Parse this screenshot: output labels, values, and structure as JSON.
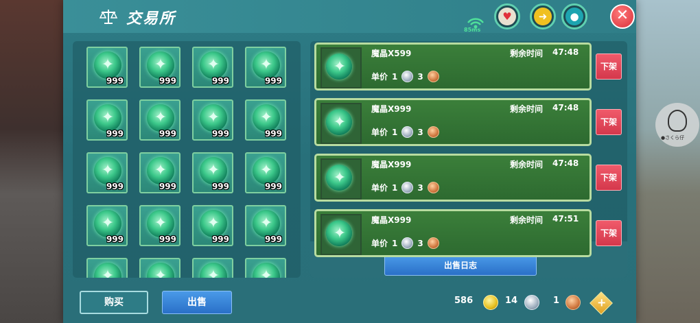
{
  "title": "交易所",
  "ping": "85ms",
  "icons": {
    "title": "balance-scale-icon",
    "close": "close-icon",
    "wifi": "wifi-icon",
    "health": "heart-icon",
    "hunger": "arrow-icon",
    "water": "water-drop-icon"
  },
  "close_label": "✕",
  "inventory": {
    "slots": [
      {
        "qty": "999"
      },
      {
        "qty": "999"
      },
      {
        "qty": "999"
      },
      {
        "qty": "999"
      },
      {
        "qty": "999"
      },
      {
        "qty": "999"
      },
      {
        "qty": "999"
      },
      {
        "qty": "999"
      },
      {
        "qty": "999"
      },
      {
        "qty": "999"
      },
      {
        "qty": "999"
      },
      {
        "qty": "999"
      },
      {
        "qty": "999"
      },
      {
        "qty": "999"
      },
      {
        "qty": "999"
      },
      {
        "qty": "999"
      },
      {
        "qty": ""
      },
      {
        "qty": ""
      },
      {
        "qty": ""
      },
      {
        "qty": ""
      }
    ]
  },
  "listings": [
    {
      "name": "魔晶X599",
      "remain_label": "剩余时间",
      "time": "47:48",
      "price_label": "单价",
      "silver": "1",
      "bronze": "3",
      "delist": "下架"
    },
    {
      "name": "魔晶X999",
      "remain_label": "剩余时间",
      "time": "47:48",
      "price_label": "单价",
      "silver": "1",
      "bronze": "3",
      "delist": "下架"
    },
    {
      "name": "魔晶X999",
      "remain_label": "剩余时间",
      "time": "47:48",
      "price_label": "单价",
      "silver": "1",
      "bronze": "3",
      "delist": "下架"
    },
    {
      "name": "魔晶X999",
      "remain_label": "剩余时间",
      "time": "47:51",
      "price_label": "单价",
      "silver": "1",
      "bronze": "3",
      "delist": "下架"
    }
  ],
  "log_button": "出售日志",
  "tabs": {
    "buy": "购买",
    "sell": "出售"
  },
  "currency": {
    "gold": "586",
    "silver": "14",
    "bronze": "1"
  },
  "plus_label": "+",
  "qq_label": "●さくら仔",
  "colors": {
    "panel": "#2e7c86",
    "listing": "#3b7f3a",
    "delist": "#e04858",
    "action": "#3a86d8"
  }
}
